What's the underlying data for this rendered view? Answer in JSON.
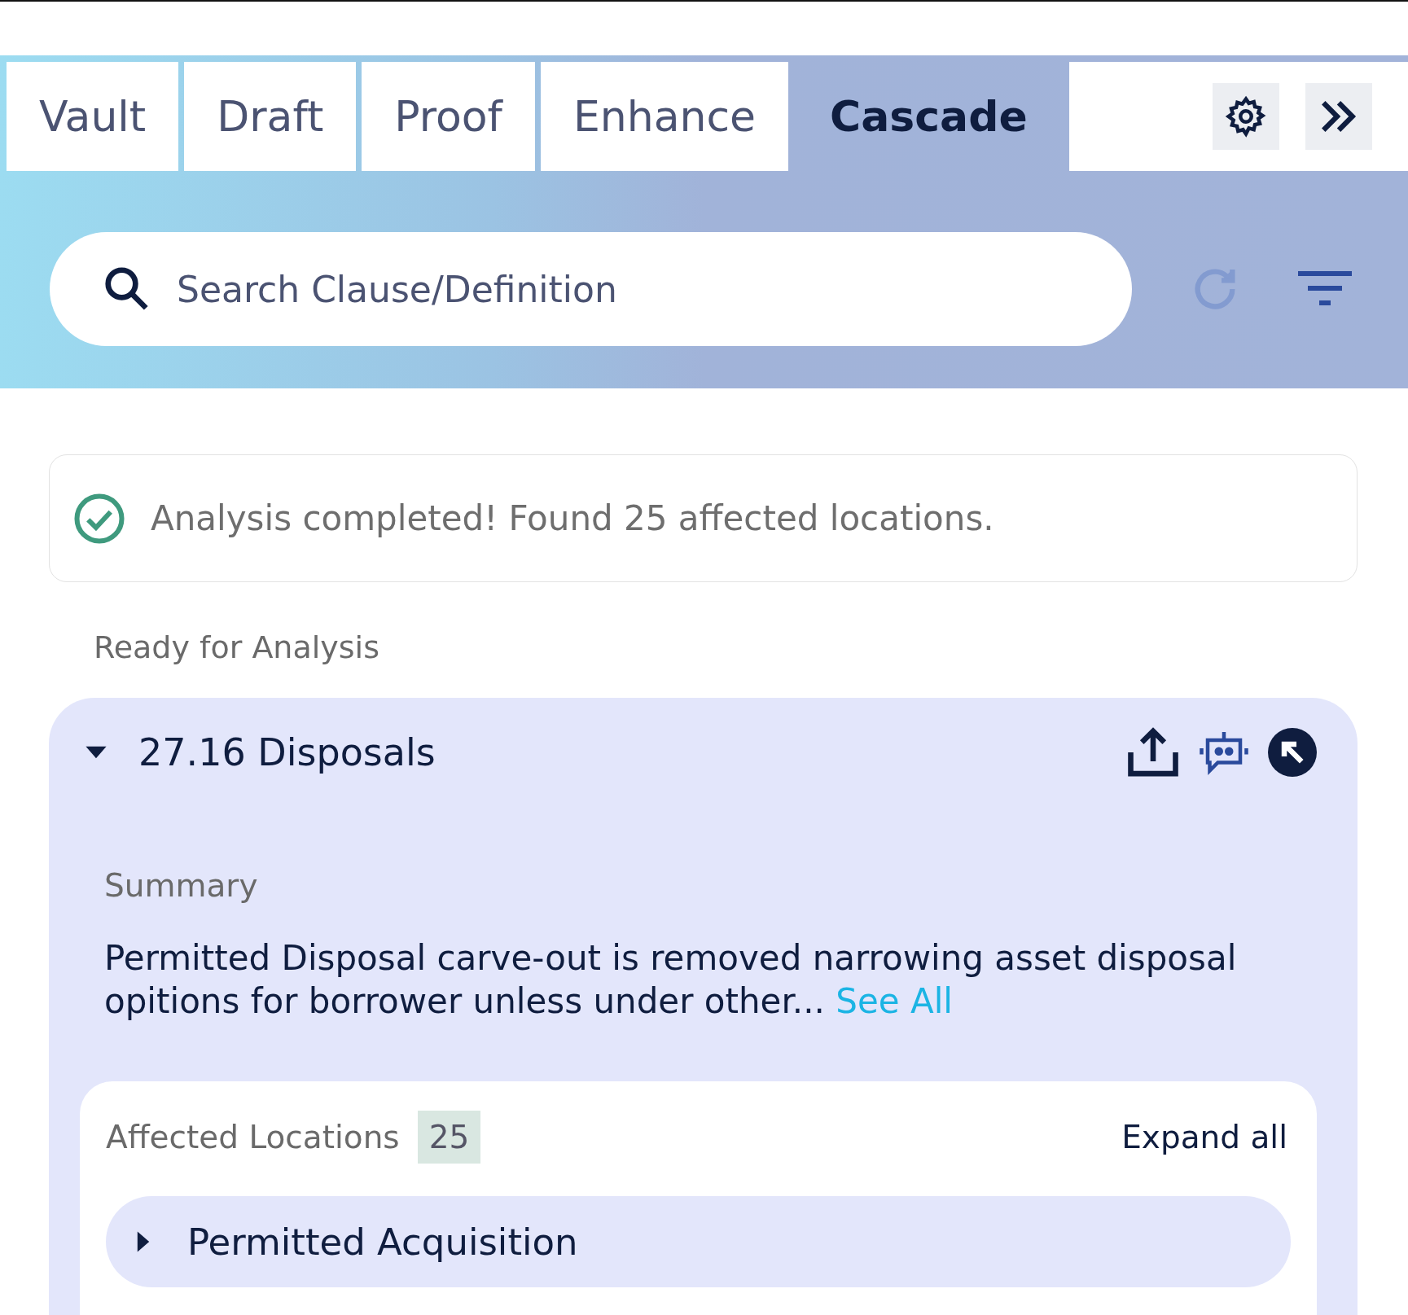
{
  "tabs": [
    {
      "label": "Vault",
      "selected": false
    },
    {
      "label": "Draft",
      "selected": false
    },
    {
      "label": "Proof",
      "selected": false
    },
    {
      "label": "Enhance",
      "selected": false
    },
    {
      "label": "Cascade",
      "selected": true
    }
  ],
  "search": {
    "placeholder": "Search Clause/Definition"
  },
  "refresh": {
    "disabled": true
  },
  "status": {
    "message": "Analysis completed! Found 25 affected locations."
  },
  "section_label": "Ready for Analysis",
  "clause": {
    "title": "27.16 Disposals",
    "expanded": true,
    "summary_label": "Summary",
    "summary": "Permitted Disposal carve-out is removed narrowing asset disposal opitions for borrower unless under other...",
    "see_all": "See All",
    "affected": {
      "label": "Affected Locations",
      "count": "25",
      "expand_all": "Expand all",
      "items": [
        {
          "title": "Permitted Acquisition",
          "expanded": false
        }
      ]
    }
  }
}
